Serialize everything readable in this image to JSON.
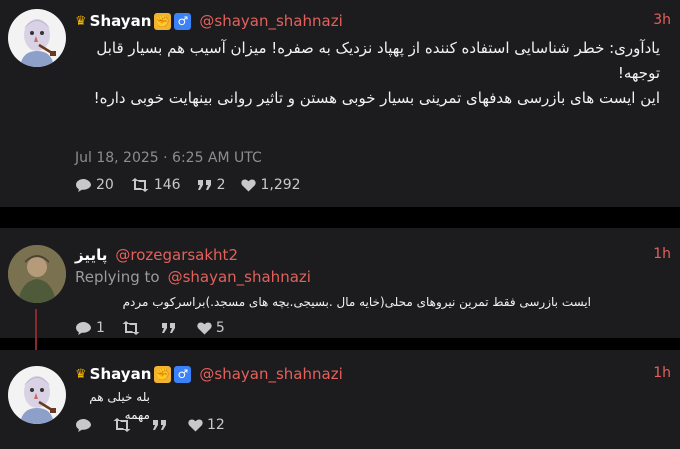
{
  "main_tweet": {
    "display_name": "Shayan",
    "handle": "@shayan_shahnazi",
    "time": "3h",
    "text_lines": [
      "یادآوری: خطر شناسایی استفاده کننده از پهپاد نزدیک به صفره! میزان آسیب هم بسیار قابل توجهه!",
      "این ایست های بازرسی هدفهای تمرینی بسیار خوبی هستن و تاثیر روانی بینهایت خوبی داره!"
    ],
    "date": "Jul 18, 2025 · 6:25 AM UTC",
    "stats": {
      "replies": "20",
      "retweets": "146",
      "quotes": "2",
      "likes": "1,292"
    }
  },
  "reply_tweet": {
    "display_name": "پاییز",
    "handle": "@rozegarsakht2",
    "time": "1h",
    "replying_label": "Replying to",
    "replying_handle": "@shayan_shahnazi",
    "text": "ایست بازرسی فقط  تمرین نیروهای محلی(خایه مال .بسیجی.بچه های مسجد.)براسرکوب مردم",
    "stats": {
      "replies": "1",
      "retweets": "",
      "quotes": "",
      "likes": "5"
    }
  },
  "self_reply_tweet": {
    "display_name": "Shayan",
    "handle": "@shayan_shahnazi",
    "time": "1h",
    "text": "بله خیلی هم مهمه",
    "stats": {
      "replies": "",
      "retweets": "",
      "quotes": "",
      "likes": "12"
    }
  },
  "colors": {
    "accent": "#e4605b",
    "card": "#1c1c1e",
    "background": "#000000"
  },
  "icons": [
    "crown-icon",
    "fist-icon",
    "male-sign-icon",
    "comment-icon",
    "retweet-icon",
    "quote-icon",
    "heart-icon"
  ]
}
